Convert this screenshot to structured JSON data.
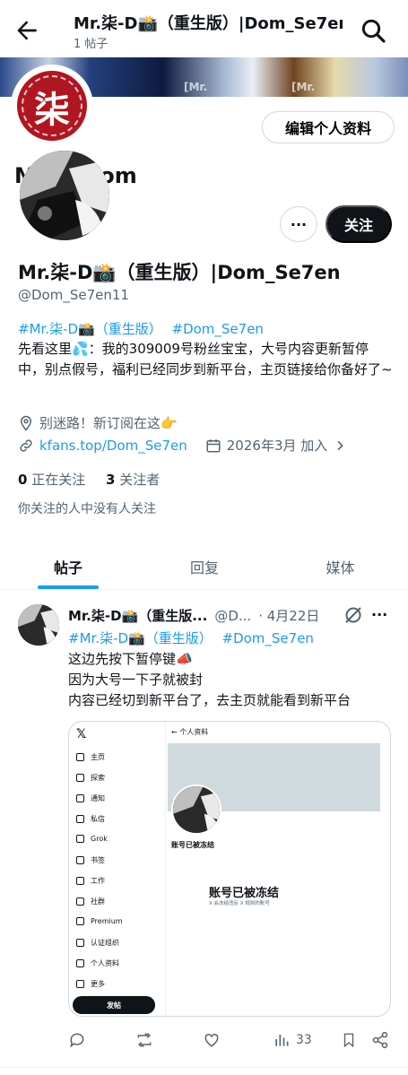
{
  "header": {
    "title": "Mr.柒-D📸（重生版）|Dom_Se7en",
    "post_count": "1 帖子"
  },
  "banner": {
    "watermark": "[Mr.",
    "watermark2": "[Mr."
  },
  "logo": {
    "glyph": "柒"
  },
  "profile": {
    "edit_label": "编辑个人资料",
    "overlay_name": "Mr.柒-Dom",
    "more_label": "···",
    "follow_label": "关注",
    "display_name": "Mr.柒-D📸（重生版）|Dom_Se7en",
    "handle": "@Dom_Se7en11",
    "bio_tag1": "#Mr.柒-D📸（重生版）",
    "bio_tag2": "#Dom_Se7en",
    "bio_text": "先看这里💦：我的309009号粉丝宝宝，大号内容更新暂停中，别点假号，福利已经同步到新平台，主页链接给你备好了~",
    "location": "别迷路！新订阅在这👉",
    "website": "kfans.top/Dom_Se7en",
    "joined": "2026年3月 加入",
    "following_count": "0",
    "following_label": "正在关注",
    "followers_count": "3",
    "followers_label": "关注者",
    "no_mutuals": "你关注的人中没有人关注"
  },
  "tabs": [
    {
      "label": "帖子"
    },
    {
      "label": "回复"
    },
    {
      "label": "媒体"
    }
  ],
  "post": {
    "name": "Mr.柒-D📸（重生版...",
    "handle": "@D...",
    "date": "· 4月22日",
    "tag1": "#Mr.柒-D📸（重生版）",
    "tag2": "#Dom_Se7en",
    "line2": "这边先按下暂停键📣",
    "line3": "因为大号一下子就被封",
    "line4": "内容已经切到新平台了，去主页就能看到新平台",
    "views": "33"
  },
  "shot": {
    "logo": "𝕏",
    "header": "←  个人资料",
    "nav": [
      "主页",
      "探索",
      "通知",
      "私信",
      "Grok",
      "书签",
      "工作",
      "社群",
      "Premium",
      "认证组织",
      "个人资料",
      "更多"
    ],
    "post_button": "发帖",
    "name": "账号已被冻结",
    "frozen_title": "账号已被冻结",
    "frozen_sub": "X 会冻结违反 X 规则的账号"
  },
  "colors": {
    "accent": "#1d9bf0",
    "text": "#0f1419",
    "muted": "#536471",
    "logo_red": "#b01621"
  }
}
